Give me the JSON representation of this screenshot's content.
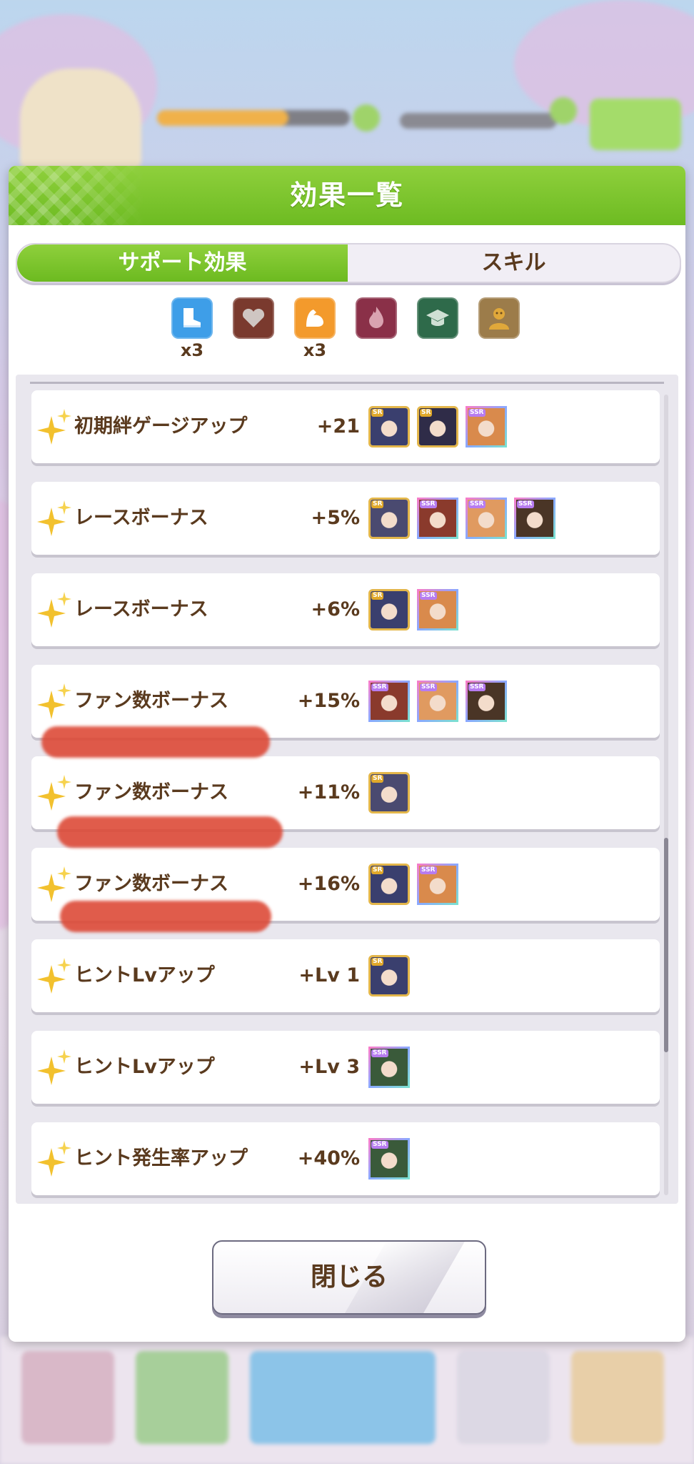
{
  "dialog": {
    "title": "効果一覧",
    "tabs": [
      {
        "label": "サポート効果",
        "active": true
      },
      {
        "label": "スキル",
        "active": false
      }
    ],
    "type_filters": [
      {
        "icon": "shoe-icon",
        "color": "#3e9ee8",
        "count": "x3"
      },
      {
        "icon": "heart-icon",
        "color": "#7a3a2e",
        "count": ""
      },
      {
        "icon": "muscle-arm-icon",
        "color": "#f39a2c",
        "count": "x3"
      },
      {
        "icon": "flame-icon",
        "color": "#8a3048",
        "count": ""
      },
      {
        "icon": "graduation-cap-icon",
        "color": "#2e6a4a",
        "count": ""
      },
      {
        "icon": "friend-face-icon",
        "color": "#9c7c4a",
        "count": ""
      }
    ],
    "effects": [
      {
        "name": "初期絆ゲージアップ",
        "value": "+21",
        "cards": [
          {
            "rarity": "SR",
            "tone": "#3a3f6e"
          },
          {
            "rarity": "SR",
            "tone": "#2f2c48"
          },
          {
            "rarity": "SSR",
            "tone": "#d98a4c"
          }
        ]
      },
      {
        "name": "レースボーナス",
        "value": "+5%",
        "cards": [
          {
            "rarity": "SR",
            "tone": "#4a4a70"
          },
          {
            "rarity": "SSR",
            "tone": "#8a3a2c"
          },
          {
            "rarity": "SSR",
            "tone": "#e09a60"
          },
          {
            "rarity": "SSR",
            "tone": "#4a3526"
          }
        ]
      },
      {
        "name": "レースボーナス",
        "value": "+6%",
        "cards": [
          {
            "rarity": "SR",
            "tone": "#3a3f6e"
          },
          {
            "rarity": "SSR",
            "tone": "#d98a4c"
          }
        ]
      },
      {
        "name": "ファン数ボーナス",
        "value": "+15%",
        "cards": [
          {
            "rarity": "SSR",
            "tone": "#8a3a2c"
          },
          {
            "rarity": "SSR",
            "tone": "#e09a60"
          },
          {
            "rarity": "SSR",
            "tone": "#4a3526"
          }
        ]
      },
      {
        "name": "ファン数ボーナス",
        "value": "+11%",
        "cards": [
          {
            "rarity": "SR",
            "tone": "#4a4a70"
          }
        ]
      },
      {
        "name": "ファン数ボーナス",
        "value": "+16%",
        "cards": [
          {
            "rarity": "SR",
            "tone": "#3a3f6e"
          },
          {
            "rarity": "SSR",
            "tone": "#d98a4c"
          }
        ]
      },
      {
        "name": "ヒントLvアップ",
        "value": "+Lv 1",
        "cards": [
          {
            "rarity": "SR",
            "tone": "#3a3f6e"
          }
        ]
      },
      {
        "name": "ヒントLvアップ",
        "value": "+Lv 3",
        "cards": [
          {
            "rarity": "SSR",
            "tone": "#3a5a3a"
          }
        ]
      },
      {
        "name": "ヒント発生率アップ",
        "value": "+40%",
        "cards": [
          {
            "rarity": "SSR",
            "tone": "#3a5a3a"
          }
        ]
      }
    ],
    "close_label": "閉じる"
  },
  "colors": {
    "header_green": "#7cc52e",
    "text_brown": "#5a3a1e",
    "sparkle_gold": "#f2c12e",
    "redaction_red": "#dc4632"
  }
}
